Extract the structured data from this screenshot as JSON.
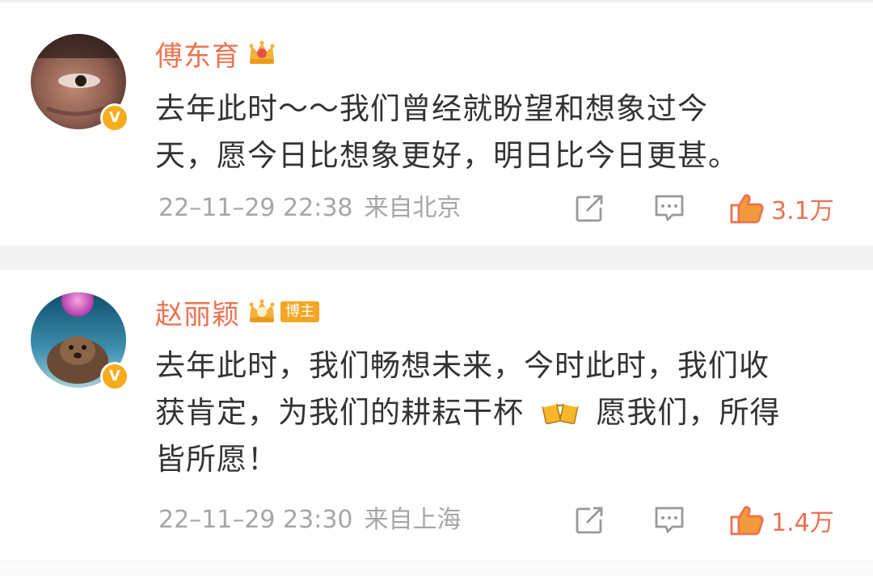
{
  "posts": [
    {
      "name": "傅东育",
      "content_lines": [
        "去年此时～～我们曾经就盼望和想象过今",
        "天，愿今日比想象更好，明日比今日更甚。"
      ],
      "time": "22–11–29 22:38",
      "source": "来自北京",
      "likes": "3.1万",
      "badge": "V",
      "vip_icon": "crown-vip-icon"
    },
    {
      "name": "赵丽颖",
      "tag": "博主",
      "content_lines": [
        "去年此时，我们畅想未来，今时此时，我们收",
        "获肯定，为我们的耕耘干杯",
        "愿我们，所得",
        "皆所愿！"
      ],
      "time": "22–11–29 23:30",
      "source": "来自上海",
      "likes": "1.4万",
      "badge": "V",
      "vip_icon": "crown-vip-icon",
      "emoji": "beer-cheers-emoji"
    }
  ],
  "colors": {
    "name": "#eb7350",
    "like": "#eb7350",
    "meta": "#a6a6a6",
    "text": "#333333",
    "badge": "#f6ac1b",
    "separator": "#f2f2f2"
  }
}
